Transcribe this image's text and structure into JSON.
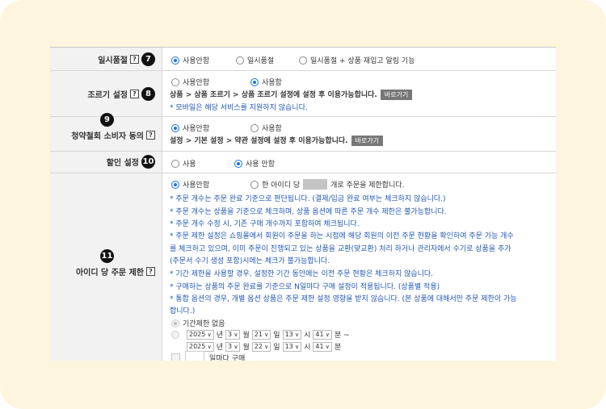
{
  "rows": {
    "pause": {
      "label": "일시품절",
      "badge": "7",
      "options": [
        "사용안함",
        "일시품절",
        "일시품절 + 상품 재입고 알림 기능"
      ]
    },
    "early": {
      "label": "조르기 설정",
      "badge": "8",
      "options": [
        "사용안함",
        "사용함"
      ],
      "path": "상품 > 상품 조르기 > 상품 조르기 설정에 설정 후 이용가능합니다.",
      "goto": "바로가기",
      "note": "* 모바일은 해당 서비스를 지원하지 않습니다."
    },
    "withdraw": {
      "label": "청약철회 소비자 동의",
      "badge": "9",
      "options": [
        "사용안함",
        "사용함"
      ],
      "path": "설정 > 기본 설정 > 약관 설정에 설정 후 이용가능합니다.",
      "goto": "바로가기"
    },
    "discount": {
      "label": "할인 설정",
      "badge": "10",
      "options": [
        "사용",
        "사용 안함"
      ]
    },
    "limit": {
      "label": "아이디 당 주문 제한",
      "badge": "11",
      "options": [
        "사용안함",
        "한 아이디 당",
        "개로 주문을 제한합니다."
      ],
      "notes": [
        "* 주문 개수는 주문 완료 기준으로 판단됩니다. (결제/입금 완료 여부는 체크하지 않습니다.)",
        "* 주문 개수는 상품을 기준으로 체크하며, 상품 옵션에 따른 주문 개수 제한은 불가능합니다.",
        "* 주문 개수 수정 시, 기존 구매 개수까지 포함하여 체크됩니다.",
        "* 주문 제한 설정은 쇼핑몰에서 회원이 주문을 하는 시점에 해당 회원의 이전 주문 현황을 확인하여 주문 가능 개수",
        "를 체크하고 있으며, 이미 주문이 진행되고 있는 상품을 교환(맞교환) 처리 하거나 관리자에서 수기로 상품을 추가",
        "(주문서 수기 생성 포함)시에는 체크가 불가능합니다.",
        "* 기간 제한을 사용할 경우, 설정한 기간 동안에는 이전 주문 현황은 체크하지 않습니다.",
        "* 구매하는 상품의 주문 완료를 기준으로 N일마다 구매 설정이 적용됩니다. (상품별 적용)",
        "* 통합 옵션의 경우, 개별 옵션 상품은 주문 제한 설정 영향을 받지 않습니다. (본 상품에 대해서만 주문 제한이 가능",
        "합니다.)"
      ],
      "period_none": "기간제한 없음",
      "from": {
        "year": "2025",
        "month": "3",
        "day": "21",
        "hour": "13",
        "minute": "41"
      },
      "to": {
        "year": "2025",
        "month": "3",
        "day": "22",
        "hour": "13",
        "minute": "41"
      },
      "units": {
        "year": "년",
        "month": "월",
        "day": "일",
        "hour": "시",
        "minute": "분",
        "range": "분 ~"
      },
      "every_days": "일마다 구매"
    }
  }
}
